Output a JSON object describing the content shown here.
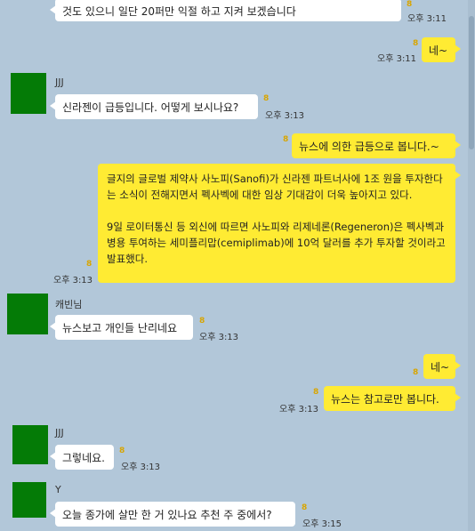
{
  "messages": [
    {
      "text": "것도 있으니 일단  20퍼만 익절 하고 지켜 보겠습니다",
      "time": "오후 3:11",
      "unread": "8"
    },
    {
      "text": "네~",
      "time": "오후 3:11",
      "unread": "8"
    },
    {
      "sender": "JJJ",
      "text": "신라젠이 급등입니다. 어떻게 보시나요?",
      "time": "오후 3:13",
      "unread": "8"
    },
    {
      "text": "뉴스에 의한 급등으로 봅니다.~",
      "unread": "8"
    },
    {
      "paragraph1": "글지의 글로벌 제약사 사노피(Sanofi)가 신라젠 파트너사에 1조 원을 투자한다는 소식이 전해지면서 펙사벡에 대한 임상 기대감이 더욱 높아지고 있다.",
      "paragraph2": "9일 로이터통신 등 외신에 따르면 사노피와 리제네론(Regeneron)은 펙사벡과 병용 투여하는 세미플리맙(cemiplimab)에 10억 달러를 추가 투자할 것이라고 발표했다.",
      "time": "오후 3:13",
      "unread": "8"
    },
    {
      "sender": "캐빈님",
      "text": "뉴스보고 개인들 난리네요",
      "time": "오후 3:13",
      "unread": "8"
    },
    {
      "text": "네~",
      "unread": "8"
    },
    {
      "text": "뉴스는 참고로만 봅니다.",
      "time": "오후 3:13",
      "unread": "8"
    },
    {
      "sender": "JJJ",
      "text": "그렇네요.",
      "time": "오후 3:13",
      "unread": "8"
    },
    {
      "sender": "Y",
      "text": "오늘 종가에 살만 한 거 있나요 추천 주 중에서?",
      "time": "오후 3:15",
      "unread": "8"
    }
  ],
  "colors": {
    "background": "#b2c7d9",
    "outgoing": "#ffeb33",
    "incoming": "#ffffff",
    "avatar": "#047b06"
  }
}
